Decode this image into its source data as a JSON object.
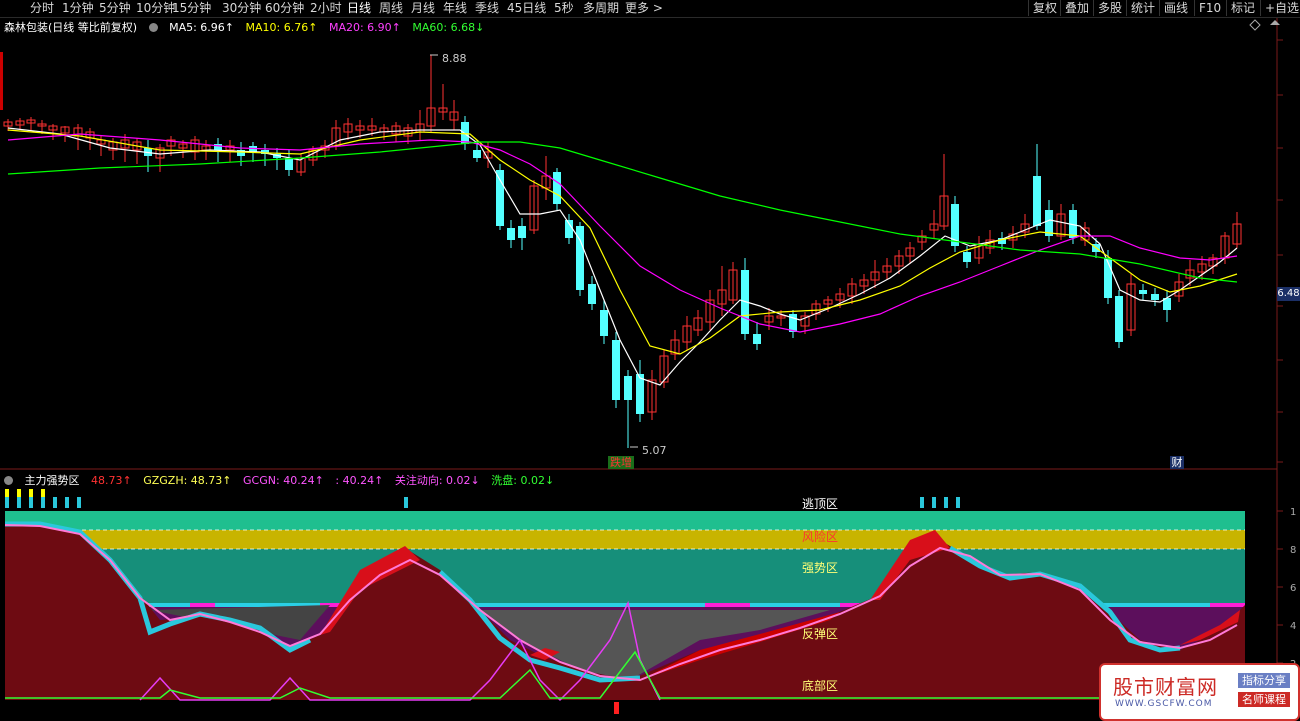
{
  "toolbar": {
    "periods": [
      "分时",
      "1分钟",
      "5分钟",
      "10分钟",
      "15分钟",
      "30分钟",
      "60分钟",
      "2小时",
      "日线",
      "周线",
      "月线",
      "年线",
      "季线",
      "45日线",
      "5秒",
      "多周期",
      "更多 >"
    ],
    "active_period": "日线",
    "right_items": [
      "复权",
      "叠加",
      "多股",
      "统计",
      "画线",
      "F10",
      "标记",
      "+自选"
    ]
  },
  "main_legend": {
    "title": "森林包装(日线 等比前复权)",
    "ma5": "MA5: 6.96↑",
    "ma10": "MA10: 6.76↑",
    "ma20": "MA20: 6.90↑",
    "ma60": "MA60: 6.68↓"
  },
  "indicator_legend": {
    "title": "主力强势区",
    "v1": "48.73↑",
    "gzgzh": "GZGZH: 48.73↑",
    "gcgn": "GCGN: 40.24↑",
    "v4": ": 40.24↑",
    "guanzhu": "关注动向: 0.02↓",
    "xipan": "洗盘: 0.02↓"
  },
  "annotations": {
    "high": "8.88",
    "low": "5.07",
    "marker_left": "跌增",
    "marker_right": "财"
  },
  "price_tag": "6.48",
  "zones": {
    "top": "逃顶区",
    "risk": "风险区",
    "strong": "强势区",
    "rebound": "反弹区",
    "bottom": "底部区"
  },
  "ind_axis": [
    "1",
    "8",
    "6",
    "4",
    "2"
  ],
  "watermark": {
    "title": "股市财富网",
    "url": "WWW.GSCFW.COM",
    "tag1": "指标分享",
    "tag2": "名师课程"
  },
  "colors": {
    "up": "#ff3232",
    "down": "#54ffff",
    "ma5": "#ffffff",
    "ma10": "#ffff00",
    "ma20": "#ff00ff",
    "ma60": "#00ff00",
    "top_zone": "#1fbf8f",
    "risk_zone": "#c8b400",
    "strong_zone": "#168f7a",
    "rebound_zone": "#5c0f5c"
  }
}
